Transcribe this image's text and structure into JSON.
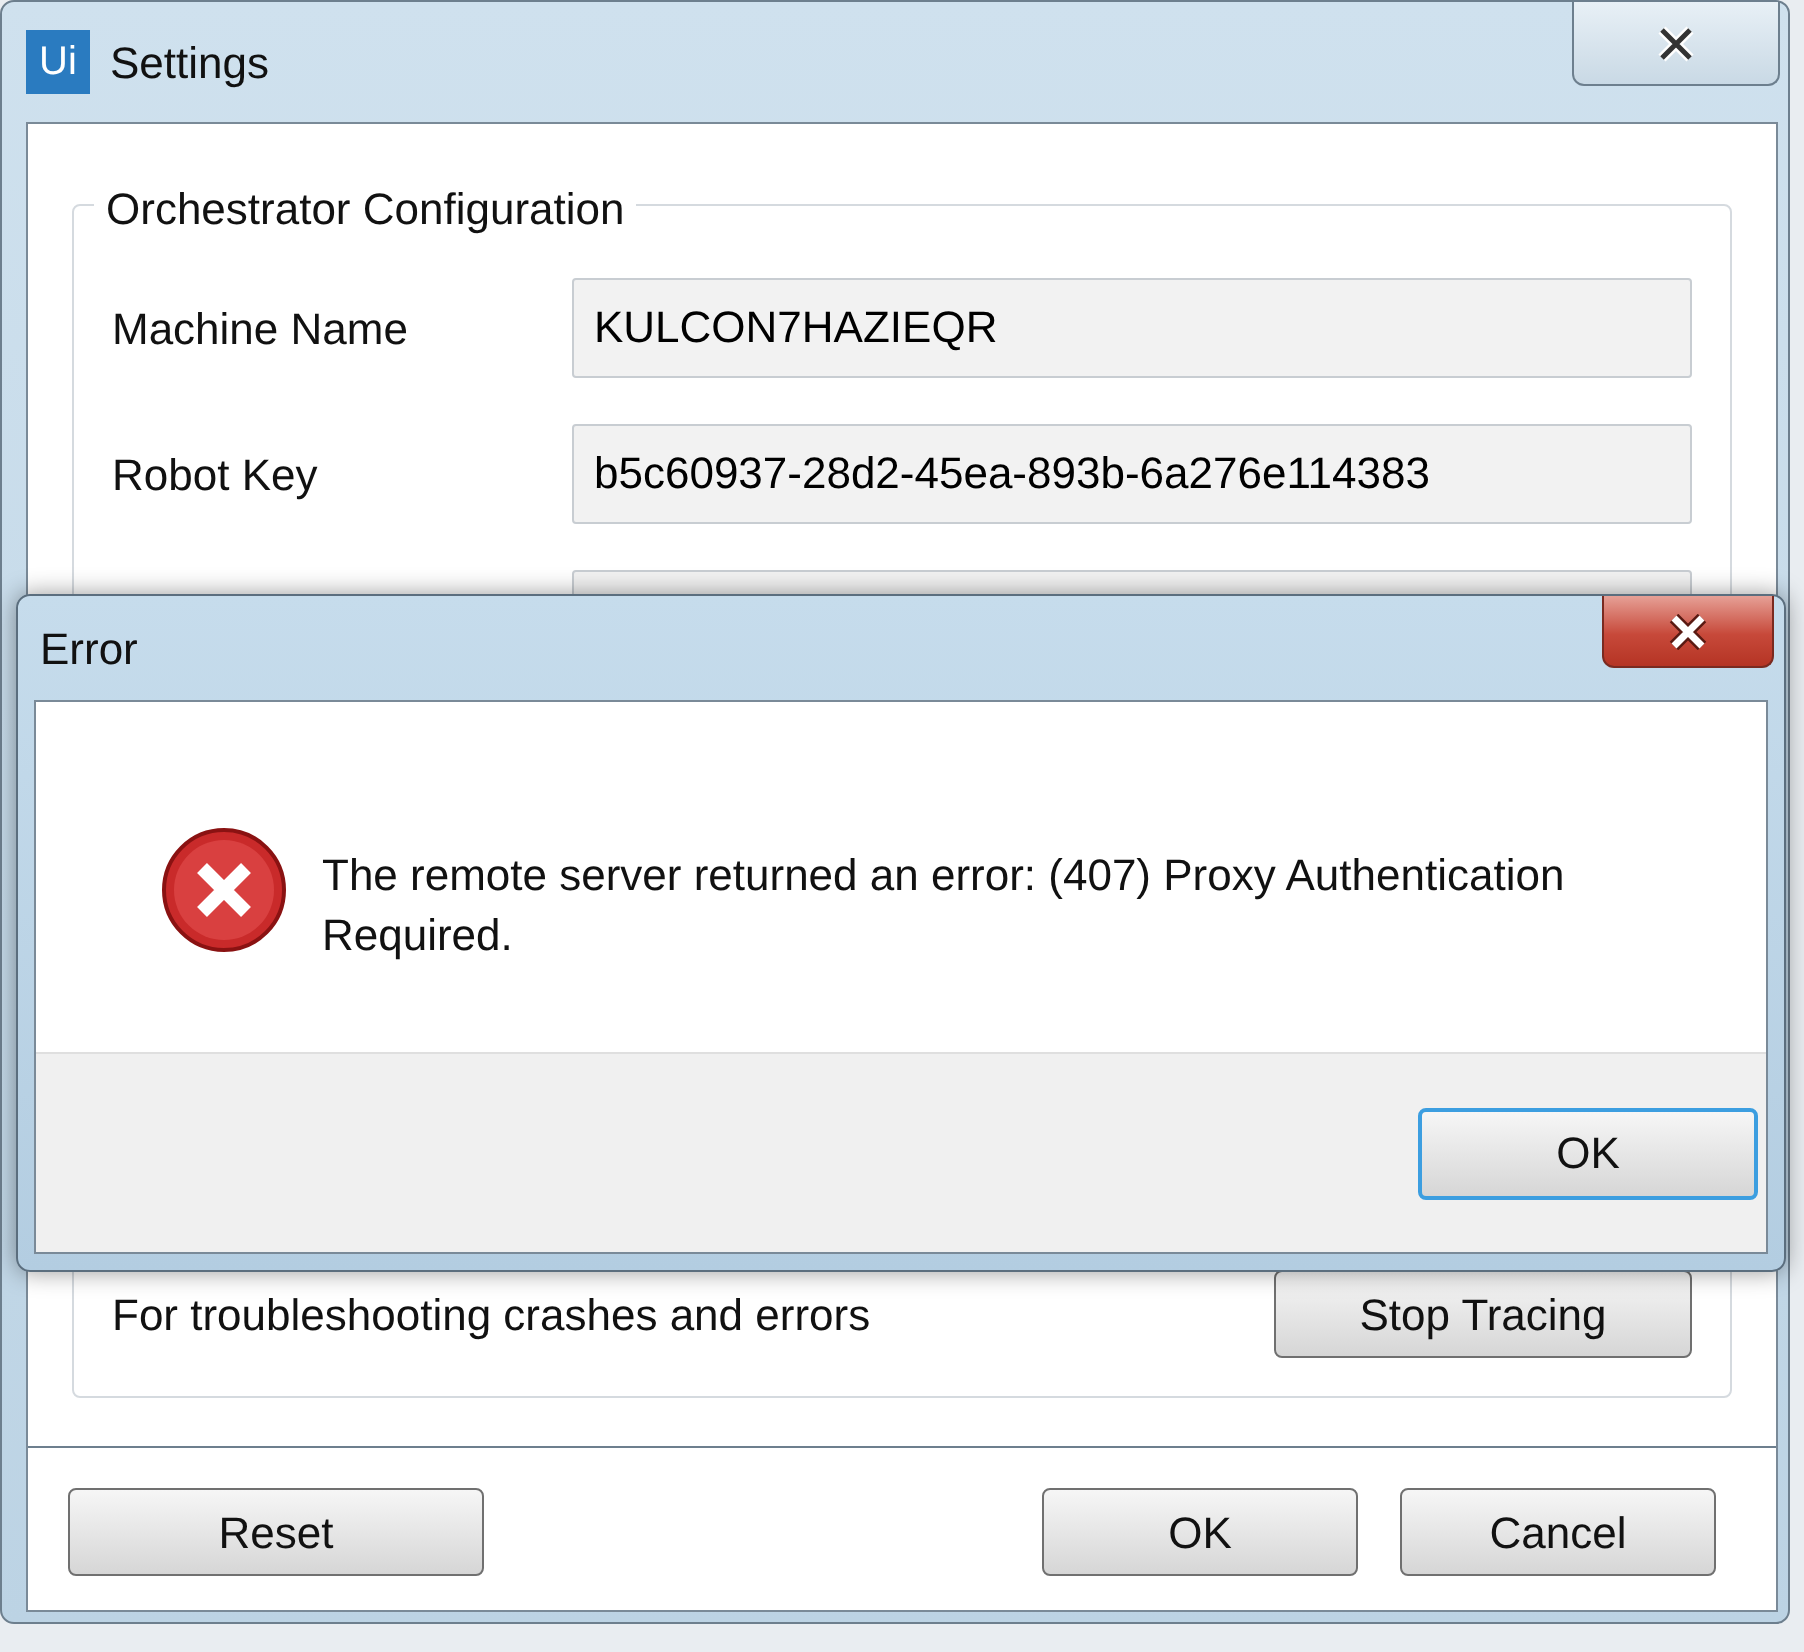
{
  "settings_window": {
    "title": "Settings",
    "app_icon": "Ui",
    "group": {
      "title": "Orchestrator Configuration",
      "fields": [
        {
          "label": "Machine Name",
          "value": "KULCON7HAZIEQR"
        },
        {
          "label": "Robot Key",
          "value": "b5c60937-28d2-45ea-893b-6a276e114383"
        }
      ]
    },
    "tracing": {
      "text": "For troubleshooting crashes and errors",
      "button": "Stop Tracing"
    },
    "buttons": [
      {
        "label": "Reset"
      },
      {
        "label": "OK"
      },
      {
        "label": "Cancel"
      }
    ]
  },
  "error_dialog": {
    "title": "Error",
    "message": "The remote server returned an error: (407) Proxy Authentication Required.",
    "buttons": [
      {
        "label": "OK",
        "default": true
      }
    ]
  }
}
